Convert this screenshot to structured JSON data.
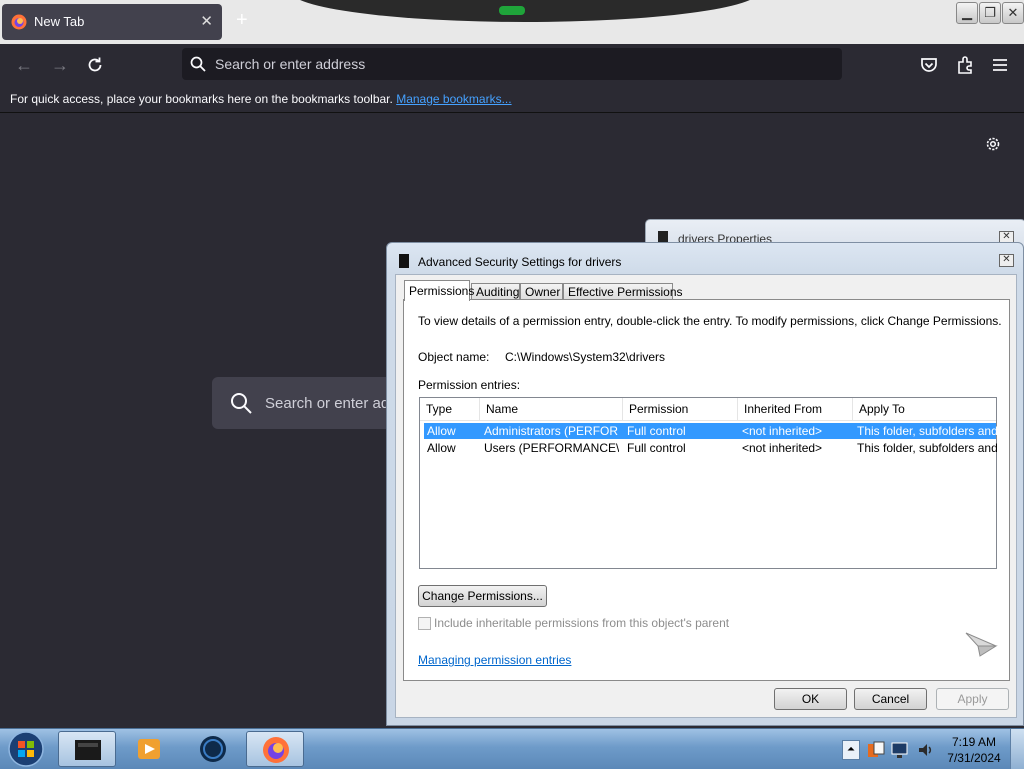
{
  "browser": {
    "tab_title": "New Tab",
    "tab_close": "✕",
    "new_tab": "+",
    "url_placeholder": "Search or enter address",
    "bookmarks_message": "For quick access, place your bookmarks here on the bookmarks toolbar.",
    "manage_bookmarks": "Manage bookmarks...",
    "content_search_placeholder": "Search or enter address"
  },
  "back_dialog": {
    "title": "drivers Properties"
  },
  "dialog": {
    "title": "Advanced Security Settings for drivers",
    "tabs": [
      "Permissions",
      "Auditing",
      "Owner",
      "Effective Permissions"
    ],
    "info_text": "To view details of a permission entry, double-click the entry. To modify permissions, click Change Permissions.",
    "object_name_label": "Object name:",
    "object_name_value": "C:\\Windows\\System32\\drivers",
    "entries_label": "Permission entries:",
    "columns": [
      "Type",
      "Name",
      "Permission",
      "Inherited From",
      "Apply To"
    ],
    "rows": [
      {
        "type": "Allow",
        "name": "Administrators (PERFOR...",
        "permission": "Full control",
        "inherited": "<not inherited>",
        "apply": "This folder, subfolders and..."
      },
      {
        "type": "Allow",
        "name": "Users (PERFORMANCE\\...",
        "permission": "Full control",
        "inherited": "<not inherited>",
        "apply": "This folder, subfolders and..."
      }
    ],
    "change_permissions": "Change Permissions...",
    "include_inheritable": "Include inheritable permissions from this object's parent",
    "managing_link": "Managing permission entries",
    "ok": "OK",
    "cancel": "Cancel",
    "apply": "Apply"
  },
  "taskbar": {
    "time": "7:19 AM",
    "date": "7/31/2024"
  },
  "colors": {
    "firefox_bg": "#2b2a33",
    "selection": "#3399ff",
    "link": "#0066cc"
  }
}
